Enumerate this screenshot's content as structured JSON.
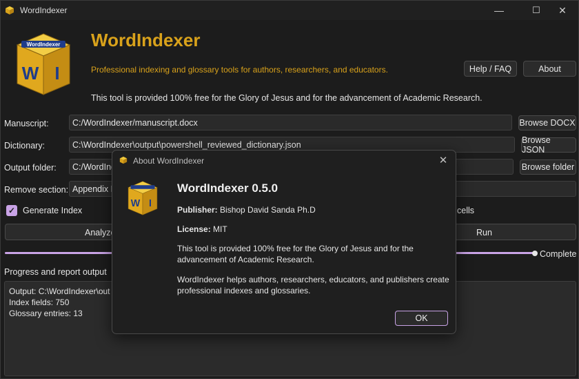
{
  "window": {
    "title": "WordIndexer",
    "controls": {
      "minimize": "—",
      "maximize": "☐",
      "close": "✕"
    }
  },
  "header": {
    "logo_text": "WordIndexer",
    "logo_letters": "W I",
    "app_name": "WordIndexer",
    "tagline": "Professional indexing and glossary tools for authors, researchers, and educators.",
    "notice": "This tool is provided 100% free for the Glory of Jesus and for the advancement of Academic Research.",
    "help_button": "Help / FAQ",
    "about_button": "About"
  },
  "form": {
    "manuscript": {
      "label": "Manuscript:",
      "value": "C:/WordIndexer/manuscript.docx",
      "button": "Browse DOCX"
    },
    "dictionary": {
      "label": "Dictionary:",
      "value": "C:\\WordIndexer\\output\\powershell_reviewed_dictionary.json",
      "button": "Browse JSON"
    },
    "output_folder": {
      "label": "Output folder:",
      "value": "C:/WordIndexer",
      "button": "Browse folder"
    },
    "remove_section": {
      "label": "Remove section:",
      "value": "Appendix F"
    },
    "generate_index": {
      "label": "Generate Index",
      "checked": true
    },
    "cells_option_label": "cells",
    "analyze_button": "Analyze",
    "run_button": "Run",
    "progress": 1.0,
    "progress_status": "Complete"
  },
  "output": {
    "label": "Progress and report output",
    "lines": [
      "Output: C:\\WordIndexer\\out",
      "Index fields: 750",
      "Glossary entries: 13"
    ]
  },
  "about_dialog": {
    "title": "About WordIndexer",
    "heading": "WordIndexer 0.5.0",
    "publisher_label": "Publisher:",
    "publisher_value": "Bishop David Sanda Ph.D",
    "license_label": "License:",
    "license_value": "MIT",
    "paragraph1": "This tool is provided 100% free for the Glory of Jesus and for the advancement of Academic Research.",
    "paragraph2": "WordIndexer helps authors, researchers, educators, and publishers create professional indexes and glossaries.",
    "ok_button": "OK"
  },
  "colors": {
    "accent_gold": "#d9a21b",
    "accent_purple": "#c9a3e6",
    "background": "#1c1c1c"
  }
}
